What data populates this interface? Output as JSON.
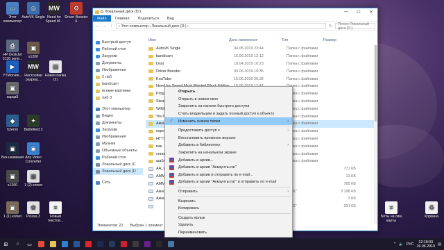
{
  "desktop": {
    "icons": [
      {
        "label": "Этот компьютер",
        "icon": "computer-icon",
        "color": "#4a7fc1",
        "glyph": "▭"
      },
      {
        "label": "AutoVK Single",
        "icon": "autovk-icon",
        "color": "#3b6fb0",
        "glyph": "◎"
      },
      {
        "label": "Need for Speed M...",
        "icon": "nfs-icon",
        "color": "#2a2a2a",
        "glyph": "MW"
      },
      {
        "label": "Driver Booster 6",
        "icon": "driver-booster-icon",
        "color": "#c0392b",
        "glyph": "⚙"
      },
      {
        "label": "HP DeskJet 2130 serie...",
        "icon": "printer-icon",
        "color": "#5a6b80",
        "glyph": "⎙"
      },
      {
        "label": "s1200",
        "icon": "image-icon",
        "color": "#6b5a4a",
        "glyph": "▣"
      },
      {
        "label": "YTMonste...",
        "icon": "ytmonster-icon",
        "color": "#1e5fbf",
        "glyph": "▶"
      },
      {
        "label": "Настройки разреш...",
        "icon": "nfs-settings-icon",
        "color": "#2a2a2a",
        "glyph": "MW"
      },
      {
        "label": "Новая папка (2)",
        "icon": "folder-doc-icon",
        "color": "#e8e8e8",
        "glyph": "▤"
      },
      {
        "label": "карцв5",
        "icon": "image-icon",
        "color": "#6a6a6a",
        "glyph": "▣"
      },
      {
        "label": "h2enm",
        "icon": "app-icon",
        "color": "#2a5e8f",
        "glyph": "◆"
      },
      {
        "label": "Battlefield 3",
        "icon": "battlefield-icon",
        "color": "#2d3b2a",
        "glyph": "✦"
      },
      {
        "label": "Без названия",
        "icon": "image-icon",
        "color": "#1d2a40",
        "glyph": "▣"
      },
      {
        "label": "Any Video Converter",
        "icon": "converter-icon",
        "color": "#3a7fd0",
        "glyph": "◉"
      },
      {
        "label": "s1200",
        "icon": "image-icon",
        "color": "#4a4a4a",
        "glyph": "▣"
      },
      {
        "label": "1 (2) копия",
        "icon": "image-icon",
        "color": "#dfdfdf",
        "glyph": "▣"
      },
      {
        "label": "1 (1) копия",
        "icon": "image-icon",
        "color": "#7a6a5a",
        "glyph": "▣"
      },
      {
        "label": "Picasa 3",
        "icon": "picasa-icon",
        "color": "#e0e0e0",
        "glyph": "✿"
      },
      {
        "label": "Новый текстов...",
        "icon": "text-file-icon",
        "color": "#f4f4f4",
        "glyph": "≡"
      },
      {
        "label": "Боты на сим карты",
        "icon": "text-file-icon",
        "color": "#f4f4f4",
        "glyph": "≡"
      },
      {
        "label": "Корзина",
        "icon": "recycle-bin-icon",
        "color": "#f0f0f0",
        "glyph": "♻"
      }
    ]
  },
  "window": {
    "title": "Локальный диск (D:)",
    "controls": {
      "minimize": "—",
      "maximize": "☐",
      "close": "✕"
    },
    "ribbon_tabs": [
      "Файл",
      "Главная",
      "Поделиться",
      "Вид"
    ],
    "address": "›  Этот компьютер  ›  Локальный диск (D:)  ›",
    "search_placeholder": "Поиск: Локальный диск (D:)",
    "columns": {
      "name": "Имя",
      "date": "Дата изменения",
      "type": "Тип",
      "size": "Размер"
    },
    "nav": [
      {
        "label": "Быстрый доступ",
        "icon": "star-icon",
        "color": "#3a8ee6"
      },
      {
        "label": "Рабочий стол",
        "icon": "desktop-icon",
        "color": "#3a8ee6"
      },
      {
        "label": "Загрузки",
        "icon": "download-icon",
        "color": "#3a8ee6"
      },
      {
        "label": "Документы",
        "icon": "documents-icon",
        "color": "#8a9bb0"
      },
      {
        "label": "Изображения",
        "icon": "pictures-icon",
        "color": "#8a9bb0"
      },
      {
        "label": "2 лаб",
        "icon": "folder-icon",
        "color": "#e8c35a"
      },
      {
        "label": "bandicam",
        "icon": "folder-icon",
        "color": "#e8c35a"
      },
      {
        "label": "всякие картинки",
        "icon": "folder-icon",
        "color": "#e8c35a"
      },
      {
        "label": "лаб 3",
        "icon": "folder-icon",
        "color": "#e8c35a"
      },
      {
        "label": "",
        "icon": "spacer",
        "color": "transparent"
      },
      {
        "label": "Этот компьютер",
        "icon": "computer-icon",
        "color": "#4a7fc1"
      },
      {
        "label": "Видео",
        "icon": "video-icon",
        "color": "#8a9bb0"
      },
      {
        "label": "Документы",
        "icon": "documents-icon",
        "color": "#8a9bb0"
      },
      {
        "label": "Загрузки",
        "icon": "download-icon",
        "color": "#3a8ee6"
      },
      {
        "label": "Изображения",
        "icon": "pictures-icon",
        "color": "#8a9bb0"
      },
      {
        "label": "Музыка",
        "icon": "music-icon",
        "color": "#8a9bb0"
      },
      {
        "label": "Объемные объекты",
        "icon": "3d-objects-icon",
        "color": "#8a9bb0"
      },
      {
        "label": "Рабочий стол",
        "icon": "desktop-icon",
        "color": "#3a8ee6"
      },
      {
        "label": "Локальный диск (C",
        "icon": "drive-icon",
        "color": "#7a8898"
      },
      {
        "label": "Локальный диск (D",
        "icon": "drive-icon",
        "color": "#7a8898",
        "selected": true
      },
      {
        "label": "",
        "icon": "spacer",
        "color": "transparent"
      },
      {
        "label": "Сеть",
        "icon": "network-icon",
        "color": "#4a7fc1"
      }
    ],
    "files": [
      {
        "name": "AutoVK Single",
        "date": "04.05.2019 23:44",
        "type": "Папка с файлами",
        "size": ""
      },
      {
        "name": "bandicam",
        "date": "16.06.2019 12:12",
        "type": "Папка с файлами",
        "size": ""
      },
      {
        "name": "Dsst",
        "date": "18.04.2019 10:23",
        "type": "Папка с файлами",
        "size": ""
      },
      {
        "name": "Driver Booster",
        "date": "03.06.2019 10:35",
        "type": "Папка с файлами",
        "size": ""
      },
      {
        "name": "KnuTube",
        "date": "15.06.2019 20:32",
        "type": "Папка с файлами",
        "size": ""
      },
      {
        "name": "Need for Speed Most Wanted Black Edition",
        "date": "15.06.2019 17:42",
        "type": "Папка с файлами",
        "size": ""
      },
      {
        "name": "Progra",
        "date": "",
        "type": "Папка с файлами",
        "size": ""
      },
      {
        "name": "Steam",
        "date": "",
        "type": "Папка с файлами",
        "size": ""
      },
      {
        "name": "WIND",
        "date": "",
        "type": "Папка с файлами",
        "size": ""
      },
      {
        "name": "YouTu",
        "date": "",
        "type": "Папка с файлами",
        "size": ""
      },
      {
        "name": "Акка",
        "date": "",
        "type": "Папка с файлами",
        "size": "",
        "highlight": true
      },
      {
        "name": "корон",
        "date": "",
        "type": "Папка с файлами",
        "size": ""
      },
      {
        "name": "НГТУ",
        "date": "",
        "type": "Папка с файлами",
        "size": ""
      },
      {
        "name": "пак",
        "date": "",
        "type": "Папка с файлами",
        "size": ""
      },
      {
        "name": "снгви",
        "date": "",
        "type": "Папка с файлами",
        "size": ""
      },
      {
        "name": "шабл",
        "date": "",
        "type": "Папка с файлами",
        "size": ""
      },
      {
        "name": "AA_v",
        "date": "",
        "type": "",
        "size": "771 КБ"
      },
      {
        "name": "AMM",
        "date": "",
        "type": "",
        "size": "13 КБ"
      },
      {
        "name": "AMMY",
        "date": "",
        "type": "",
        "size": "785 КБ"
      },
      {
        "name": "Акка",
        "date": "",
        "type": "\"APK\"",
        "size": "3 198 КБ"
      },
      {
        "name": "Акка",
        "date": "",
        "type": "",
        "size": "3 КБ"
      },
      {
        "name": "",
        "date": "",
        "type": "\"JPG\"",
        "size": "201 КБ"
      }
    ],
    "status": {
      "count": "Элементов: 22",
      "selected": "Выбран 1 элемент"
    }
  },
  "context_menu": {
    "items": [
      {
        "label": "Открыть",
        "bold": true,
        "icon": ""
      },
      {
        "label": "Открыть в новом окне",
        "icon": ""
      },
      {
        "label": "Закрепить на панели быстрого доступа",
        "icon": ""
      },
      {
        "label": "Стать владельцем и задать полный доступ к объекту",
        "icon": ""
      },
      {
        "label": "Изменить значок папки",
        "icon": "paint-icon",
        "submenu": true,
        "highlight": true
      },
      {
        "sep": true
      },
      {
        "label": "Предоставить доступ к",
        "submenu": true,
        "icon": ""
      },
      {
        "label": "Восстановить прежнюю версию",
        "icon": ""
      },
      {
        "label": "Добавить в библиотеку",
        "submenu": true,
        "icon": ""
      },
      {
        "label": "Закрепить на начальном экране",
        "icon": ""
      },
      {
        "label": "Добавить в архив...",
        "icon": "winrar-icon"
      },
      {
        "label": "Добавить в архив \"Аккаунты.rar\"",
        "icon": "winrar-icon"
      },
      {
        "label": "Добавить в архив и отправить по e-mail...",
        "icon": "winrar-icon"
      },
      {
        "label": "Добавить в архив \"Аккаунты.rar\" и отправить по e-mail",
        "icon": "winrar-icon"
      },
      {
        "sep": true
      },
      {
        "label": "Отправить",
        "submenu": true,
        "icon": ""
      },
      {
        "sep": true
      },
      {
        "label": "Вырезать",
        "icon": ""
      },
      {
        "label": "Копировать",
        "icon": ""
      },
      {
        "sep": true
      },
      {
        "label": "Создать ярлык",
        "icon": ""
      },
      {
        "label": "Удалить",
        "icon": ""
      },
      {
        "label": "Переименовать",
        "icon": ""
      },
      {
        "sep": true
      },
      {
        "label": "Свойства",
        "icon": ""
      }
    ]
  },
  "taskbar": {
    "apps": [
      {
        "icon": "start-icon",
        "color": "#ffffff",
        "glyph": "⊞"
      },
      {
        "icon": "search-icon",
        "color": "#ffffff",
        "glyph": "○"
      },
      {
        "icon": "task-view-icon",
        "color": "#ffffff",
        "glyph": "▭"
      },
      {
        "icon": "chrome-icon",
        "color": "#e44c3c",
        "glyph": ""
      },
      {
        "icon": "explorer-icon",
        "color": "#e8c35a",
        "glyph": ""
      },
      {
        "icon": "store-icon",
        "color": "#2f7fd4",
        "glyph": ""
      },
      {
        "icon": "word-icon",
        "color": "#2b579a",
        "glyph": ""
      },
      {
        "icon": "yandex-icon",
        "color": "#e0242a",
        "glyph": ""
      },
      {
        "icon": "photoshop-icon",
        "color": "#1b2a52",
        "glyph": ""
      },
      {
        "icon": "steam-icon",
        "color": "#223a5e",
        "glyph": ""
      },
      {
        "icon": "opera-icon",
        "color": "#c9222e",
        "glyph": ""
      },
      {
        "icon": "vegas-icon",
        "color": "#3b3b3b",
        "glyph": ""
      },
      {
        "icon": "app-icon",
        "color": "#6a1f8f",
        "glyph": ""
      },
      {
        "icon": "terminal-icon",
        "color": "#2a2a2a",
        "glyph": ""
      },
      {
        "icon": "vk-icon",
        "color": "#4a76a8",
        "glyph": ""
      }
    ],
    "language": "РУС",
    "time": "12:18:03",
    "date": "16.06.2019"
  }
}
